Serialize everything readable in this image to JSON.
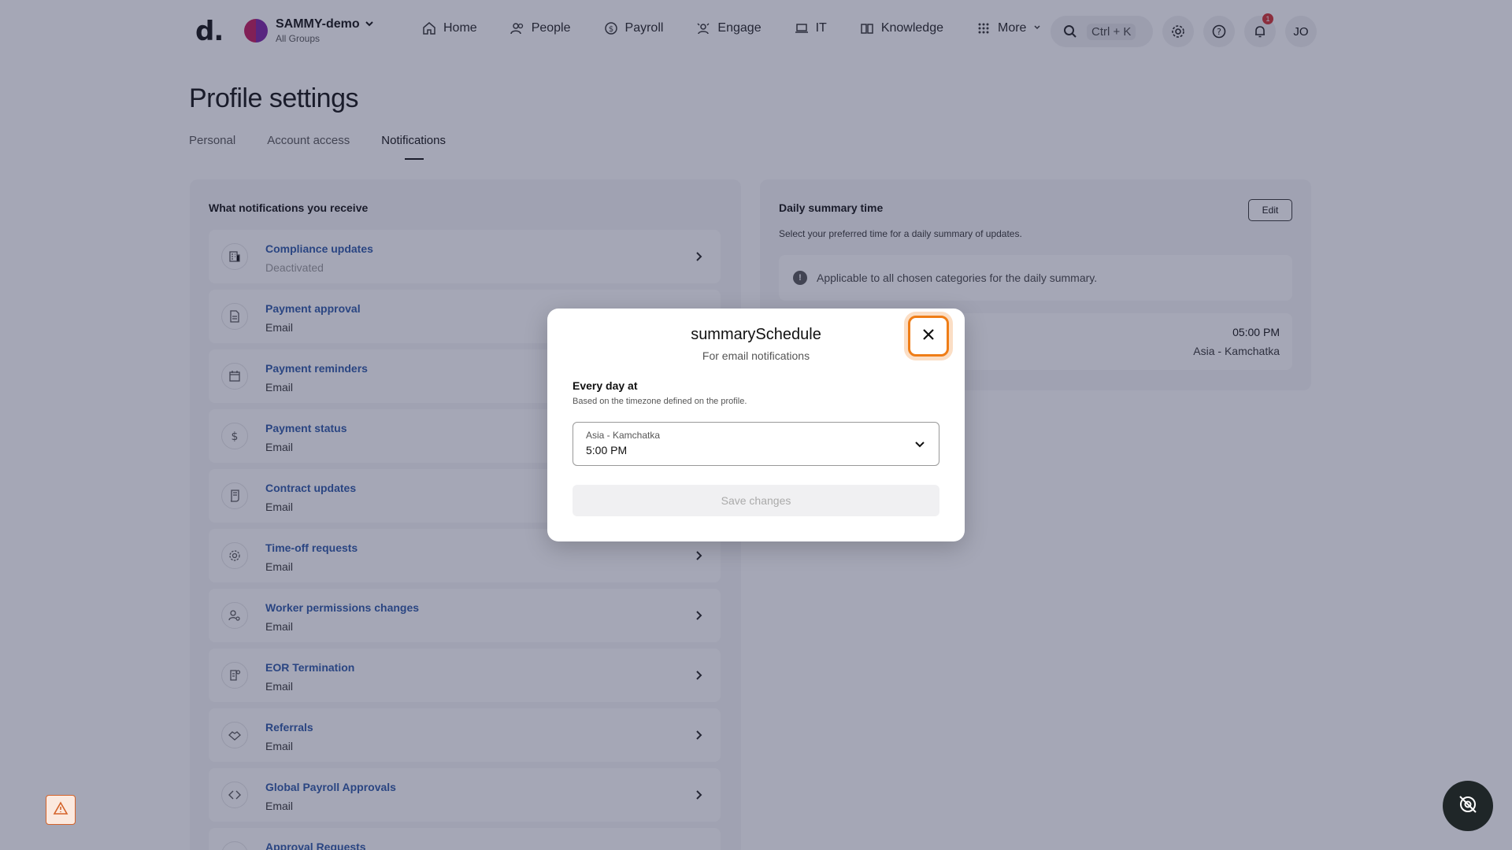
{
  "nav": {
    "logo": "d.",
    "org_name": "SAMMY-demo",
    "org_sub": "All Groups",
    "links": [
      {
        "label": "Home",
        "icon": "home-icon"
      },
      {
        "label": "People",
        "icon": "people-icon"
      },
      {
        "label": "Payroll",
        "icon": "payroll-icon"
      },
      {
        "label": "Engage",
        "icon": "engage-icon"
      },
      {
        "label": "IT",
        "icon": "laptop-icon"
      },
      {
        "label": "Knowledge",
        "icon": "book-icon"
      },
      {
        "label": "More",
        "icon": "grid-icon"
      }
    ],
    "search_shortcut": "Ctrl + K",
    "notification_count": "1",
    "user_initials": "JO"
  },
  "page": {
    "title": "Profile settings",
    "tabs": [
      "Personal",
      "Account access",
      "Notifications"
    ],
    "active_tab": "Notifications"
  },
  "notifications": {
    "heading": "What notifications you receive",
    "items": [
      {
        "title": "Compliance updates",
        "sub": "Deactivated",
        "icon": "building-icon"
      },
      {
        "title": "Payment approval",
        "sub": "Email",
        "icon": "document-icon"
      },
      {
        "title": "Payment reminders",
        "sub": "Email",
        "icon": "calendar-icon"
      },
      {
        "title": "Payment status",
        "sub": "Email",
        "icon": "dollar-icon"
      },
      {
        "title": "Contract updates",
        "sub": "Email",
        "icon": "contract-icon"
      },
      {
        "title": "Time-off requests",
        "sub": "Email",
        "icon": "gear-icon"
      },
      {
        "title": "Worker permissions changes",
        "sub": "Email",
        "icon": "user-gear-icon"
      },
      {
        "title": "EOR Termination",
        "sub": "Email",
        "icon": "termination-icon"
      },
      {
        "title": "Referrals",
        "sub": "Email",
        "icon": "handshake-icon"
      },
      {
        "title": "Global Payroll Approvals",
        "sub": "Email",
        "icon": "code-icon"
      },
      {
        "title": "Approval Requests",
        "sub": "",
        "icon": "approval-icon"
      }
    ]
  },
  "summary": {
    "title": "Daily summary time",
    "edit_label": "Edit",
    "description": "Select your preferred time for a daily summary of updates.",
    "info": "Applicable to all chosen categories for the daily summary.",
    "time": "05:00 PM",
    "timezone": "Asia - Kamchatka"
  },
  "modal": {
    "title": "summarySchedule",
    "subtitle": "For email notifications",
    "label": "Every day at",
    "hint": "Based on the timezone defined on the profile.",
    "select_label": "Asia - Kamchatka",
    "select_value": "5:00 PM",
    "save_label": "Save changes"
  },
  "colors": {
    "accent_close": "#ef7d17",
    "link_blue": "#2b57a6",
    "overlay": "#282d50"
  }
}
